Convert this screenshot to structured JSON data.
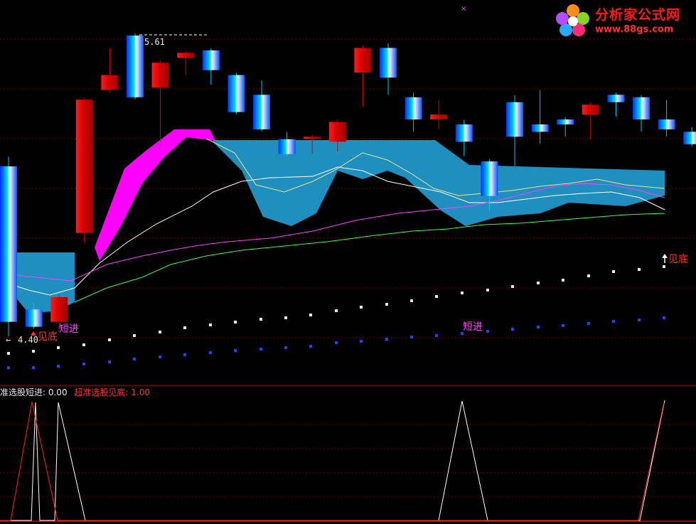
{
  "logo": {
    "name": "分析家公式网",
    "url": "www.88gs.com"
  },
  "colors": {
    "background": "#000000",
    "up_candle": "#e00000",
    "down_candle": "#00c8ff",
    "band_fill": "#1e8fbf",
    "magenta_fill": "#ff00ff",
    "ma_white": "#ffffff",
    "ma_yellow": "#e8e88a",
    "ma_magenta": "#ff40ff",
    "ma_green": "#3cff3c",
    "grid": "#800000",
    "dots_white": "#e8e8e8",
    "dots_blue": "#2a3cff",
    "sub_white": "#ffffff",
    "sub_red": "#ff2020"
  },
  "annotations": {
    "high_label": "5.61",
    "low_label": "4.40",
    "marker_duanjin_1": "短进",
    "marker_duanjin_2": "短进",
    "marker_jiandi_1": "见底",
    "marker_jiandi_2": "见底"
  },
  "sub_panel": {
    "legend_a": "准选股短进: 0.00",
    "legend_b": "超准选股见底: 1.00"
  },
  "chart_data": {
    "type": "candlestick",
    "candles": [
      {
        "o": 5.08,
        "h": 5.11,
        "l": 4.4,
        "c": 4.45
      },
      {
        "o": 4.5,
        "h": 4.52,
        "l": 4.47,
        "c": 4.43
      },
      {
        "o": 4.45,
        "h": 4.46,
        "l": 4.42,
        "c": 4.55
      },
      {
        "o": 4.81,
        "h": 5.2,
        "l": 4.78,
        "c": 5.35
      },
      {
        "o": 5.39,
        "h": 5.55,
        "l": 5.39,
        "c": 5.45
      },
      {
        "o": 5.61,
        "h": 5.61,
        "l": 5.38,
        "c": 5.36
      },
      {
        "o": 5.4,
        "h": 5.38,
        "l": 5.17,
        "c": 5.5
      },
      {
        "o": 5.52,
        "h": 5.54,
        "l": 5.46,
        "c": 5.54
      },
      {
        "o": 5.55,
        "h": 5.55,
        "l": 5.42,
        "c": 5.47
      },
      {
        "o": 5.45,
        "h": 5.39,
        "l": 5.33,
        "c": 5.3
      },
      {
        "o": 5.37,
        "h": 5.42,
        "l": 5.28,
        "c": 5.23
      },
      {
        "o": 5.19,
        "h": 5.21,
        "l": 5.13,
        "c": 5.13
      },
      {
        "o": 5.2,
        "h": 5.18,
        "l": 5.14,
        "c": 5.2
      },
      {
        "o": 5.18,
        "h": 5.2,
        "l": 5.15,
        "c": 5.26
      },
      {
        "o": 5.46,
        "h": 5.49,
        "l": 5.33,
        "c": 5.56
      },
      {
        "o": 5.56,
        "h": 5.57,
        "l": 5.38,
        "c": 5.44
      },
      {
        "o": 5.36,
        "h": 5.37,
        "l": 5.23,
        "c": 5.27
      },
      {
        "o": 5.27,
        "h": 5.34,
        "l": 5.24,
        "c": 5.29
      },
      {
        "o": 5.25,
        "h": 5.26,
        "l": 5.13,
        "c": 5.18
      },
      {
        "o": 5.1,
        "h": 5.03,
        "l": 4.91,
        "c": 4.96
      },
      {
        "o": 5.34,
        "h": 5.36,
        "l": 5.09,
        "c": 5.2
      },
      {
        "o": 5.25,
        "h": 5.38,
        "l": 5.18,
        "c": 5.22
      },
      {
        "o": 5.27,
        "h": 5.27,
        "l": 5.21,
        "c": 5.25
      },
      {
        "o": 5.29,
        "h": 5.27,
        "l": 5.2,
        "c": 5.33
      },
      {
        "o": 5.37,
        "h": 5.37,
        "l": 5.29,
        "c": 5.34
      },
      {
        "o": 5.36,
        "h": 5.34,
        "l": 5.23,
        "c": 5.27
      },
      {
        "o": 5.27,
        "h": 5.34,
        "l": 5.21,
        "c": 5.23
      },
      {
        "o": 5.22,
        "h": 5.23,
        "l": 5.19,
        "c": 5.17
      }
    ],
    "ylim": [
      4.3,
      5.7
    ]
  }
}
